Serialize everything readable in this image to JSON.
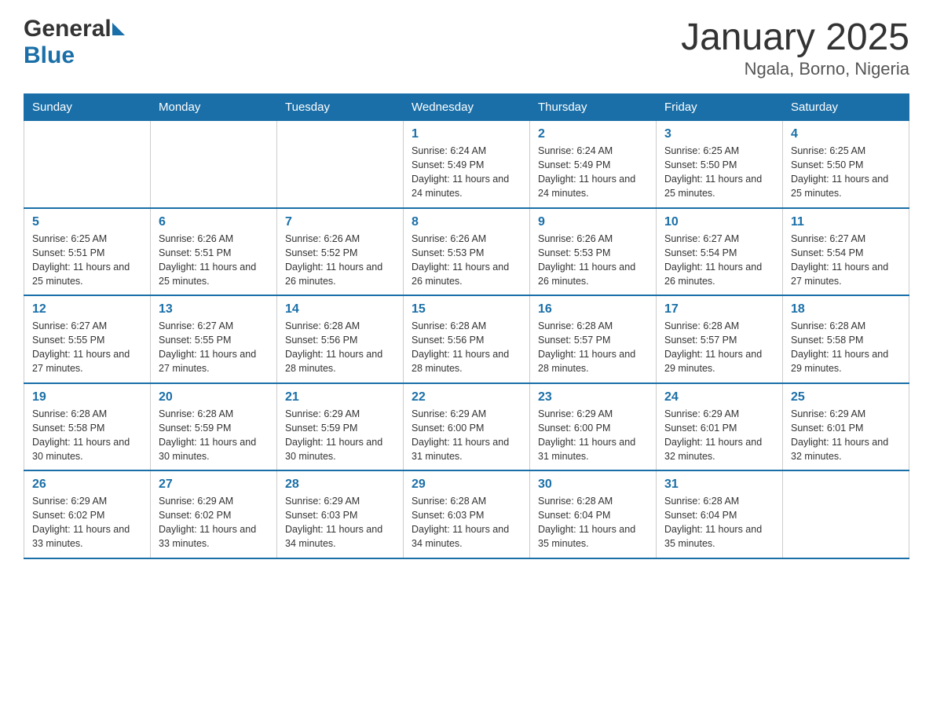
{
  "header": {
    "logo_general": "General",
    "logo_blue": "Blue",
    "title": "January 2025",
    "subtitle": "Ngala, Borno, Nigeria"
  },
  "days_of_week": [
    "Sunday",
    "Monday",
    "Tuesday",
    "Wednesday",
    "Thursday",
    "Friday",
    "Saturday"
  ],
  "weeks": [
    [
      {
        "day": "",
        "info": ""
      },
      {
        "day": "",
        "info": ""
      },
      {
        "day": "",
        "info": ""
      },
      {
        "day": "1",
        "info": "Sunrise: 6:24 AM\nSunset: 5:49 PM\nDaylight: 11 hours and 24 minutes."
      },
      {
        "day": "2",
        "info": "Sunrise: 6:24 AM\nSunset: 5:49 PM\nDaylight: 11 hours and 24 minutes."
      },
      {
        "day": "3",
        "info": "Sunrise: 6:25 AM\nSunset: 5:50 PM\nDaylight: 11 hours and 25 minutes."
      },
      {
        "day": "4",
        "info": "Sunrise: 6:25 AM\nSunset: 5:50 PM\nDaylight: 11 hours and 25 minutes."
      }
    ],
    [
      {
        "day": "5",
        "info": "Sunrise: 6:25 AM\nSunset: 5:51 PM\nDaylight: 11 hours and 25 minutes."
      },
      {
        "day": "6",
        "info": "Sunrise: 6:26 AM\nSunset: 5:51 PM\nDaylight: 11 hours and 25 minutes."
      },
      {
        "day": "7",
        "info": "Sunrise: 6:26 AM\nSunset: 5:52 PM\nDaylight: 11 hours and 26 minutes."
      },
      {
        "day": "8",
        "info": "Sunrise: 6:26 AM\nSunset: 5:53 PM\nDaylight: 11 hours and 26 minutes."
      },
      {
        "day": "9",
        "info": "Sunrise: 6:26 AM\nSunset: 5:53 PM\nDaylight: 11 hours and 26 minutes."
      },
      {
        "day": "10",
        "info": "Sunrise: 6:27 AM\nSunset: 5:54 PM\nDaylight: 11 hours and 26 minutes."
      },
      {
        "day": "11",
        "info": "Sunrise: 6:27 AM\nSunset: 5:54 PM\nDaylight: 11 hours and 27 minutes."
      }
    ],
    [
      {
        "day": "12",
        "info": "Sunrise: 6:27 AM\nSunset: 5:55 PM\nDaylight: 11 hours and 27 minutes."
      },
      {
        "day": "13",
        "info": "Sunrise: 6:27 AM\nSunset: 5:55 PM\nDaylight: 11 hours and 27 minutes."
      },
      {
        "day": "14",
        "info": "Sunrise: 6:28 AM\nSunset: 5:56 PM\nDaylight: 11 hours and 28 minutes."
      },
      {
        "day": "15",
        "info": "Sunrise: 6:28 AM\nSunset: 5:56 PM\nDaylight: 11 hours and 28 minutes."
      },
      {
        "day": "16",
        "info": "Sunrise: 6:28 AM\nSunset: 5:57 PM\nDaylight: 11 hours and 28 minutes."
      },
      {
        "day": "17",
        "info": "Sunrise: 6:28 AM\nSunset: 5:57 PM\nDaylight: 11 hours and 29 minutes."
      },
      {
        "day": "18",
        "info": "Sunrise: 6:28 AM\nSunset: 5:58 PM\nDaylight: 11 hours and 29 minutes."
      }
    ],
    [
      {
        "day": "19",
        "info": "Sunrise: 6:28 AM\nSunset: 5:58 PM\nDaylight: 11 hours and 30 minutes."
      },
      {
        "day": "20",
        "info": "Sunrise: 6:28 AM\nSunset: 5:59 PM\nDaylight: 11 hours and 30 minutes."
      },
      {
        "day": "21",
        "info": "Sunrise: 6:29 AM\nSunset: 5:59 PM\nDaylight: 11 hours and 30 minutes."
      },
      {
        "day": "22",
        "info": "Sunrise: 6:29 AM\nSunset: 6:00 PM\nDaylight: 11 hours and 31 minutes."
      },
      {
        "day": "23",
        "info": "Sunrise: 6:29 AM\nSunset: 6:00 PM\nDaylight: 11 hours and 31 minutes."
      },
      {
        "day": "24",
        "info": "Sunrise: 6:29 AM\nSunset: 6:01 PM\nDaylight: 11 hours and 32 minutes."
      },
      {
        "day": "25",
        "info": "Sunrise: 6:29 AM\nSunset: 6:01 PM\nDaylight: 11 hours and 32 minutes."
      }
    ],
    [
      {
        "day": "26",
        "info": "Sunrise: 6:29 AM\nSunset: 6:02 PM\nDaylight: 11 hours and 33 minutes."
      },
      {
        "day": "27",
        "info": "Sunrise: 6:29 AM\nSunset: 6:02 PM\nDaylight: 11 hours and 33 minutes."
      },
      {
        "day": "28",
        "info": "Sunrise: 6:29 AM\nSunset: 6:03 PM\nDaylight: 11 hours and 34 minutes."
      },
      {
        "day": "29",
        "info": "Sunrise: 6:28 AM\nSunset: 6:03 PM\nDaylight: 11 hours and 34 minutes."
      },
      {
        "day": "30",
        "info": "Sunrise: 6:28 AM\nSunset: 6:04 PM\nDaylight: 11 hours and 35 minutes."
      },
      {
        "day": "31",
        "info": "Sunrise: 6:28 AM\nSunset: 6:04 PM\nDaylight: 11 hours and 35 minutes."
      },
      {
        "day": "",
        "info": ""
      }
    ]
  ]
}
